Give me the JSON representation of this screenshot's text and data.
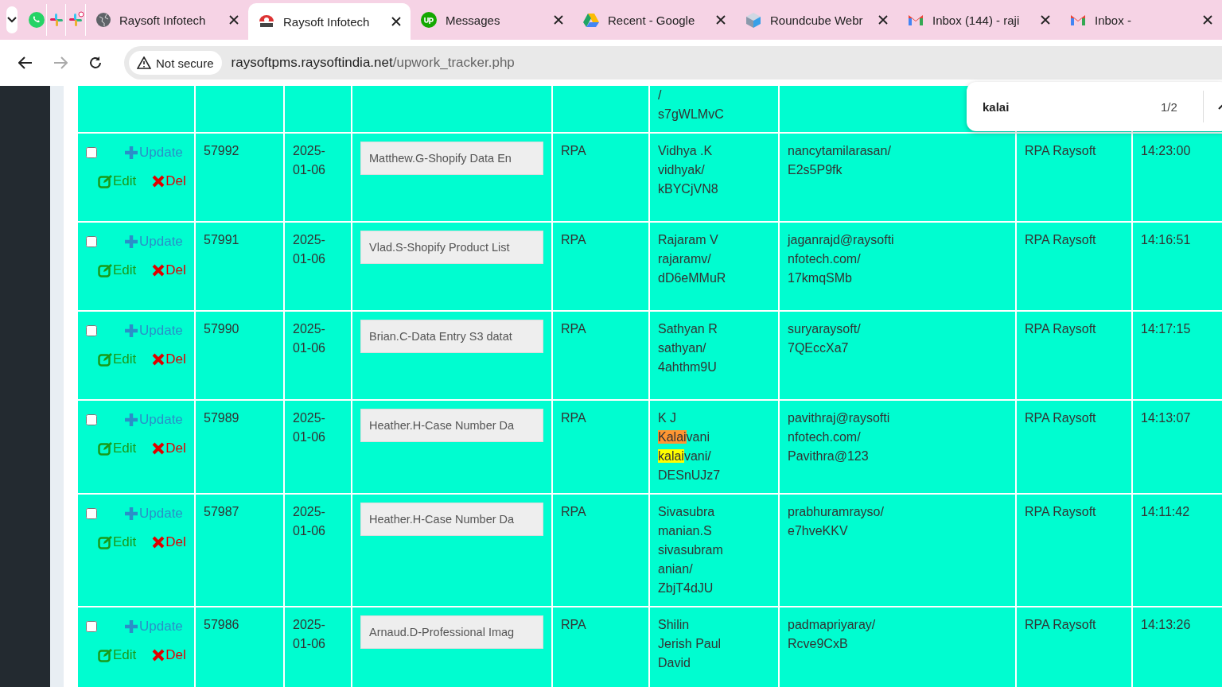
{
  "browser": {
    "tabs": [
      {
        "kind": "pinned",
        "selected": false
      },
      {
        "kind": "pinned",
        "selected": false
      },
      {
        "kind": "pinned",
        "selected": false
      },
      {
        "kind": "tab",
        "title": "Raysoft Infotech",
        "selected": false
      },
      {
        "kind": "tab",
        "title": "Raysoft Infotech",
        "selected": true
      },
      {
        "kind": "tab",
        "title": "Messages",
        "selected": false
      },
      {
        "kind": "tab",
        "title": "Recent - Google",
        "selected": false
      },
      {
        "kind": "tab",
        "title": "Roundcube Webr",
        "selected": false
      },
      {
        "kind": "tab",
        "title": "Inbox (144) - raji",
        "selected": false
      },
      {
        "kind": "tab",
        "title": "Inbox -",
        "selected": false
      }
    ],
    "security": "Not secure",
    "url_host": "raysoftpms.raysoftindia.net",
    "url_path": "/upwork_tracker.php",
    "forward_disabled": true
  },
  "find_bar": {
    "query": "kalai",
    "count": "1/2"
  },
  "table": {
    "partial_row": {
      "name": [
        "/",
        "s7gWLMvC"
      ]
    },
    "rows": [
      {
        "checked": false,
        "update": "Update",
        "edit": "Edit",
        "del": "Del",
        "id": "57992",
        "date": [
          "2025-",
          "01-06"
        ],
        "title": "Matthew.G-Shopify Data En",
        "type": "RPA",
        "name": [
          "Vidhya .K",
          "vidhyak/",
          "kBYCjVN8"
        ],
        "account": [
          "nancytamilarasan/",
          "E2s5P9fk"
        ],
        "team": "RPA Raysoft",
        "time": "14:23:00"
      },
      {
        "checked": false,
        "update": "Update",
        "edit": "Edit",
        "del": "Del",
        "id": "57991",
        "date": [
          "2025-",
          "01-06"
        ],
        "title": "Vlad.S-Shopify Product List",
        "type": "RPA",
        "name": [
          "Rajaram V",
          "rajaramv/",
          "dD6eMMuR"
        ],
        "account": [
          "jaganrajd@raysofti",
          "nfotech.com/",
          "17kmqSMb"
        ],
        "team": "RPA Raysoft",
        "time": "14:16:51"
      },
      {
        "checked": false,
        "update": "Update",
        "edit": "Edit",
        "del": "Del",
        "id": "57990",
        "date": [
          "2025-",
          "01-06"
        ],
        "title": "Brian.C-Data Entry S3 datat",
        "type": "RPA",
        "name": [
          "Sathyan R",
          "sathyan/",
          "4ahthm9U"
        ],
        "account": [
          "suryaraysoft/",
          "7QEccXa7"
        ],
        "team": "RPA Raysoft",
        "time": "14:17:15"
      },
      {
        "checked": false,
        "update": "Update",
        "edit": "Edit",
        "del": "Del",
        "id": "57989",
        "date": [
          "2025-",
          "01-06"
        ],
        "title": "Heather.H-Case Number Da",
        "type": "RPA",
        "name": [
          "K J",
          [
            {
              "text": "Kalai",
              "highlighted": true,
              "selected": true
            },
            {
              "text": "vani"
            }
          ],
          [
            {
              "text": "kalai",
              "highlighted": true,
              "selected": false
            },
            {
              "text": "vani/"
            }
          ],
          "DESnUJz7"
        ],
        "account": [
          "pavithraj@raysofti",
          "nfotech.com/",
          "Pavithra@123"
        ],
        "team": "RPA Raysoft",
        "time": "14:13:07"
      },
      {
        "checked": false,
        "update": "Update",
        "edit": "Edit",
        "del": "Del",
        "id": "57987",
        "date": [
          "2025-",
          "01-06"
        ],
        "title": "Heather.H-Case Number Da",
        "type": "RPA",
        "name": [
          "Sivasubra",
          "manian.S",
          "sivasubram",
          "anian/",
          "ZbjT4dJU"
        ],
        "account": [
          "prabhuramrayso/",
          "e7hveKKV"
        ],
        "team": "RPA Raysoft",
        "time": "14:11:42"
      },
      {
        "checked": false,
        "update": "Update",
        "edit": "Edit",
        "del": "Del",
        "id": "57986",
        "date": [
          "2025-",
          "01-06"
        ],
        "title": "Arnaud.D-Professional Imag",
        "type": "RPA",
        "name": [
          "Shilin",
          "Jerish Paul",
          "David"
        ],
        "account": [
          "padmapriyaray/",
          "Rcve9CxB"
        ],
        "team": "RPA Raysoft",
        "time": "14:13:26"
      }
    ]
  }
}
